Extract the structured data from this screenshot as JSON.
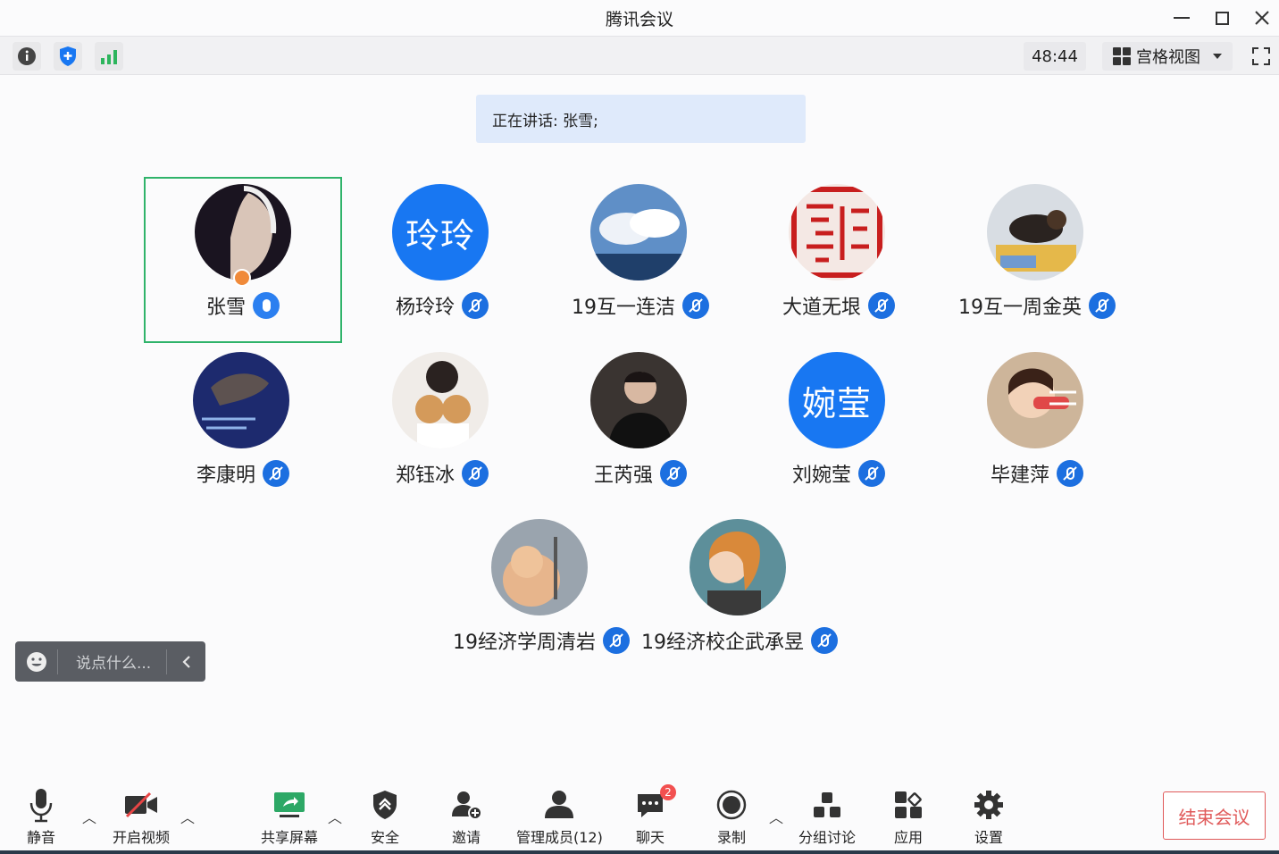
{
  "window": {
    "title": "腾讯会议"
  },
  "toolbar": {
    "timer": "48:44",
    "view_label": "宫格视图"
  },
  "banner": {
    "speaking": "正在讲话: 张雪;"
  },
  "participants": [
    {
      "name": "张雪",
      "avatar_text": ""
    },
    {
      "name": "杨玲玲",
      "avatar_text": "玲玲"
    },
    {
      "name": "19互一连洁",
      "avatar_text": ""
    },
    {
      "name": "大道无垠",
      "avatar_text": ""
    },
    {
      "name": "19互一周金英",
      "avatar_text": ""
    },
    {
      "name": "李康明",
      "avatar_text": ""
    },
    {
      "name": "郑钰冰",
      "avatar_text": ""
    },
    {
      "name": "王芮强",
      "avatar_text": ""
    },
    {
      "name": "刘婉莹",
      "avatar_text": "婉莹"
    },
    {
      "name": "毕建萍",
      "avatar_text": ""
    },
    {
      "name": "19经济学周清岩",
      "avatar_text": ""
    },
    {
      "name": "19经济校企武承昱",
      "avatar_text": ""
    }
  ],
  "chat": {
    "placeholder": "说点什么..."
  },
  "bottom": {
    "mute": "静音",
    "video": "开启视频",
    "share": "共享屏幕",
    "security": "安全",
    "invite": "邀请",
    "members": "管理成员(12)",
    "chat": "聊天",
    "chat_badge": "2",
    "record": "录制",
    "breakout": "分组讨论",
    "apps": "应用",
    "settings": "设置",
    "end": "结束会议"
  },
  "colors": {
    "accent": "#1877f2",
    "active_border": "#2fb36a",
    "end": "#e05a5a"
  }
}
